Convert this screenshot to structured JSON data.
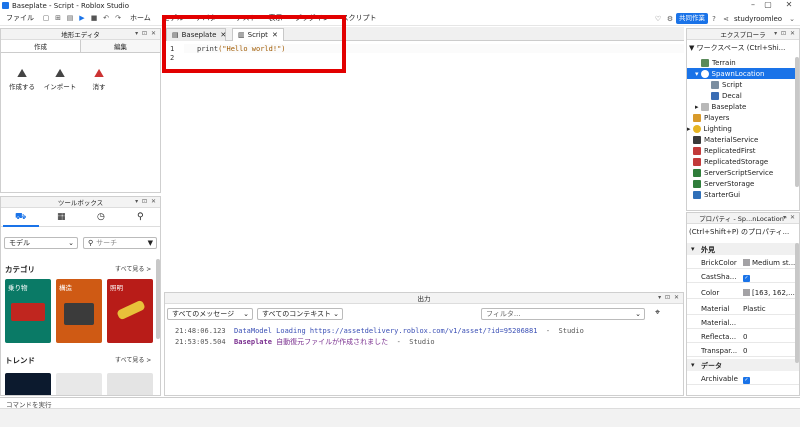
{
  "window": {
    "title": "Baseplate - Script - Roblox Studio"
  },
  "menu": {
    "items": [
      "ファイル",
      "ホーム",
      "モデル",
      "アバター",
      "テスト",
      "表示",
      "プラグイン",
      "スクリプト"
    ],
    "share_label": "共同作業",
    "user": "studyroomleo"
  },
  "left_editor": {
    "title": "地形エディタ",
    "tabs": [
      "作成",
      "編集"
    ],
    "tools": [
      "作成する",
      "インポート",
      "消す"
    ]
  },
  "toolbox": {
    "title": "ツールボックス",
    "dropdown": "モデル",
    "search_placeholder": "サーチ",
    "category_title": "カテゴリ",
    "see_all": "すべて見る >",
    "categories": [
      "乗り物",
      "構造",
      "照明"
    ],
    "trend_title": "トレンド"
  },
  "editor": {
    "tabs": [
      "Baseplate",
      "Script"
    ],
    "line_numbers": [
      "1",
      "2"
    ],
    "code_fn": "print",
    "code_arg": "(\"Hello world!\")"
  },
  "explorer": {
    "title": "エクスプローラ",
    "root": "ワークスペース (Ctrl+Shi...",
    "items": [
      "Terrain",
      "SpawnLocation",
      "Script",
      "Decal",
      "Baseplate",
      "Players",
      "Lighting",
      "MaterialService",
      "ReplicatedFirst",
      "ReplicatedStorage",
      "ServerScriptService",
      "ServerStorage",
      "StarterGui"
    ]
  },
  "properties": {
    "title": "プロパティ - Sp...nLocation\"",
    "filter": "(Ctrl+Shift+P) のプロパティ...",
    "sec_appearance": "外見",
    "rows": [
      {
        "k": "BrickColor",
        "v": "Medium st..."
      },
      {
        "k": "CastSha...",
        "v": ""
      },
      {
        "k": "Color",
        "v": "[163, 162,..."
      },
      {
        "k": "Material",
        "v": "Plastic"
      },
      {
        "k": "Material...",
        "v": ""
      },
      {
        "k": "Reflecta...",
        "v": "0"
      },
      {
        "k": "Transpar...",
        "v": "0"
      }
    ],
    "sec_data": "データ",
    "archivable": "Archivable"
  },
  "output": {
    "title": "出力",
    "messages_select": "すべてのメッセージ",
    "context_select": "すべてのコンテキスト",
    "filter_placeholder": "フィルタ...",
    "lines": [
      {
        "time": "21:48:06.123",
        "msg": "DataModel Loading https://assetdelivery.roblox.com/v1/asset/?id=95206881",
        "sep": "  -  ",
        "src": "Studio"
      },
      {
        "time": "21:53:05.504",
        "msg_bold": "Baseplate",
        "msg": " 自動復元ファイルが作成されました",
        "sep": "  -  ",
        "src": "Studio"
      }
    ]
  },
  "command": {
    "placeholder": "コマンドを実行"
  },
  "colors": {
    "accent": "#1a73e8",
    "highlight_box": "#e20000",
    "share_btn": "#1a73e8"
  }
}
